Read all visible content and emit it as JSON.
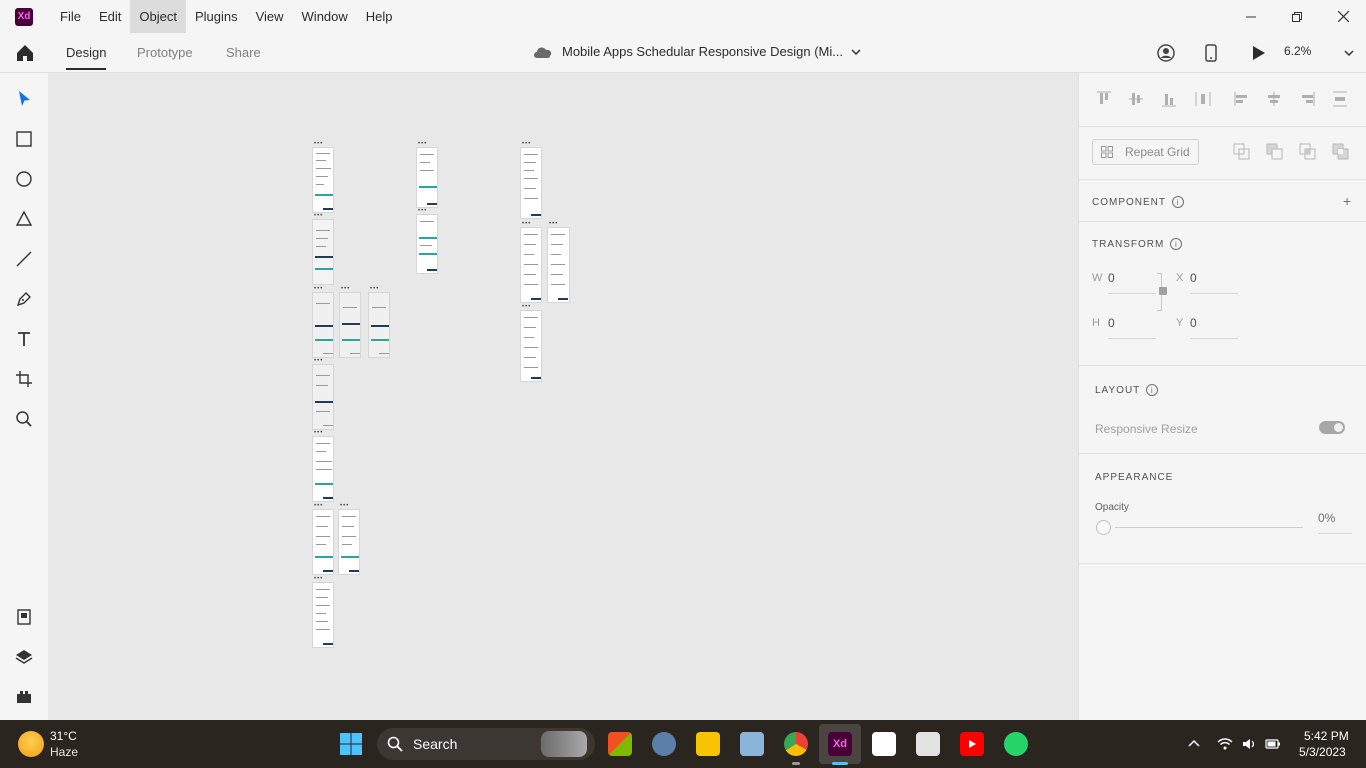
{
  "app": {
    "logo": "Xd",
    "menu": [
      "File",
      "Edit",
      "Object",
      "Plugins",
      "View",
      "Window",
      "Help"
    ],
    "active_menu": "Object"
  },
  "header": {
    "tabs": [
      "Design",
      "Prototype",
      "Share"
    ],
    "active_tab": "Design",
    "document_title": "Mobile Apps Schedular Responsive Design (Mi...",
    "zoom": "6.2%"
  },
  "panel": {
    "repeat_grid": "Repeat Grid",
    "component": "COMPONENT",
    "transform": "TRANSFORM",
    "w_label": "W",
    "w_value": "0",
    "x_label": "X",
    "x_value": "0",
    "h_label": "H",
    "h_value": "0",
    "y_label": "Y",
    "y_value": "0",
    "layout": "LAYOUT",
    "responsive_resize": "Responsive Resize",
    "appearance": "APPEARANCE",
    "opacity_label": "Opacity",
    "opacity_value": "0%"
  },
  "taskbar": {
    "weather_temp": "31°C",
    "weather_desc": "Haze",
    "search_label": "Search",
    "time": "5:42 PM",
    "date": "5/3/2023"
  },
  "colors": {
    "xd_bg": "#470137",
    "xd_fg": "#ff61f6",
    "accent": "#1473e6",
    "teal": "#2aa4a0"
  }
}
